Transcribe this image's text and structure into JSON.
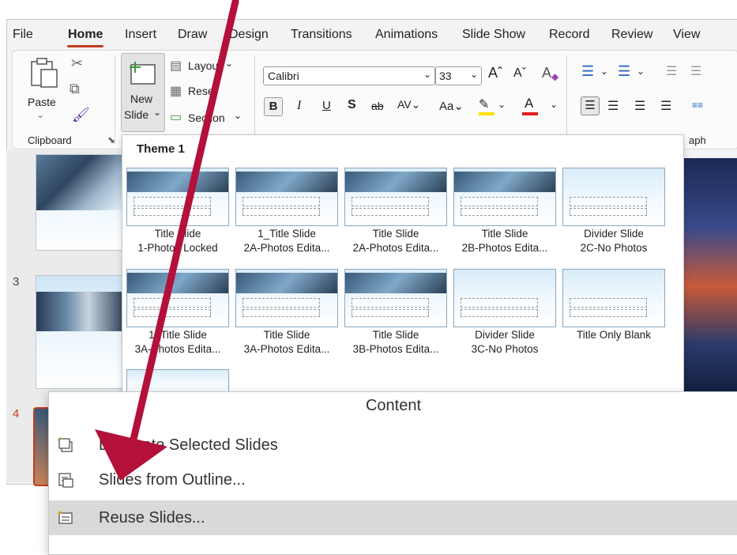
{
  "ribbon_tabs": [
    "File",
    "Home",
    "Insert",
    "Draw",
    "Design",
    "Transitions",
    "Animations",
    "Slide Show",
    "Record",
    "Review",
    "View"
  ],
  "clipboard": {
    "paste_label": "Paste",
    "group_label": "Clipboard"
  },
  "slides": {
    "new_slide_top": "New",
    "new_slide_bottom": "Slide",
    "layout_label": "Layout",
    "reset_label": "Reset",
    "section_label": "Section"
  },
  "font": {
    "name": "Calibri",
    "size": "33"
  },
  "paragraph": {
    "group_label": "aph"
  },
  "theme_panel": {
    "title": "Theme 1"
  },
  "layouts": [
    {
      "line1": "Title Slide",
      "line2": "1-Photos Locked"
    },
    {
      "line1": "1_Title Slide",
      "line2": "2A-Photos Edita..."
    },
    {
      "line1": "Title Slide",
      "line2": "2A-Photos Edita..."
    },
    {
      "line1": "Title Slide",
      "line2": "2B-Photos Edita..."
    },
    {
      "line1": "Divider Slide",
      "line2": "2C-No Photos"
    },
    {
      "line1": "1_Title Slide",
      "line2": "3A-Photos Edita..."
    },
    {
      "line1": "Title Slide",
      "line2": "3A-Photos Edita..."
    },
    {
      "line1": "Title Slide",
      "line2": "3B-Photos Edita..."
    },
    {
      "line1": "Divider Slide",
      "line2": "3C-No Photos"
    },
    {
      "line1": "Title Only Blank",
      "line2": ""
    }
  ],
  "slide_numbers": [
    "3",
    "4"
  ],
  "menu": {
    "header": "Content",
    "items": [
      {
        "label": "Duplicate Selected Slides",
        "icon": "duplicate-slides-icon",
        "highlighted": false
      },
      {
        "label": "Slides from Outline...",
        "icon": "slides-outline-icon",
        "highlighted": false
      },
      {
        "label": "Reuse Slides...",
        "icon": "reuse-slides-icon",
        "highlighted": true
      }
    ]
  },
  "accent_colors": {
    "ribbon_tab_underline": "#c43e1c",
    "arrow": "#b3103a",
    "highlight": "#d9d9d9"
  }
}
